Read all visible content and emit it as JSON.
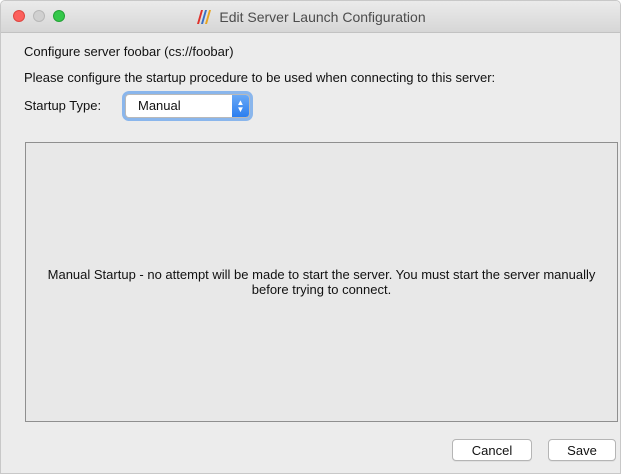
{
  "window": {
    "title": "Edit Server Launch Configuration",
    "app_icon": "paraview-logo-icon"
  },
  "dialog": {
    "configure_line": "Configure server foobar (cs://foobar)",
    "instruction": "Please configure the startup procedure to be used when connecting to this server:",
    "startup_type_label": "Startup Type:",
    "startup_type_value": "Manual",
    "panel_message": "Manual Startup - no attempt will be made to start the server.  You must start the server manually before trying to connect."
  },
  "buttons": {
    "cancel_label": "Cancel",
    "save_label": "Save"
  },
  "colors": {
    "accent": "#2b7ef0",
    "close": "#fc605c",
    "maximize": "#34c84a"
  }
}
